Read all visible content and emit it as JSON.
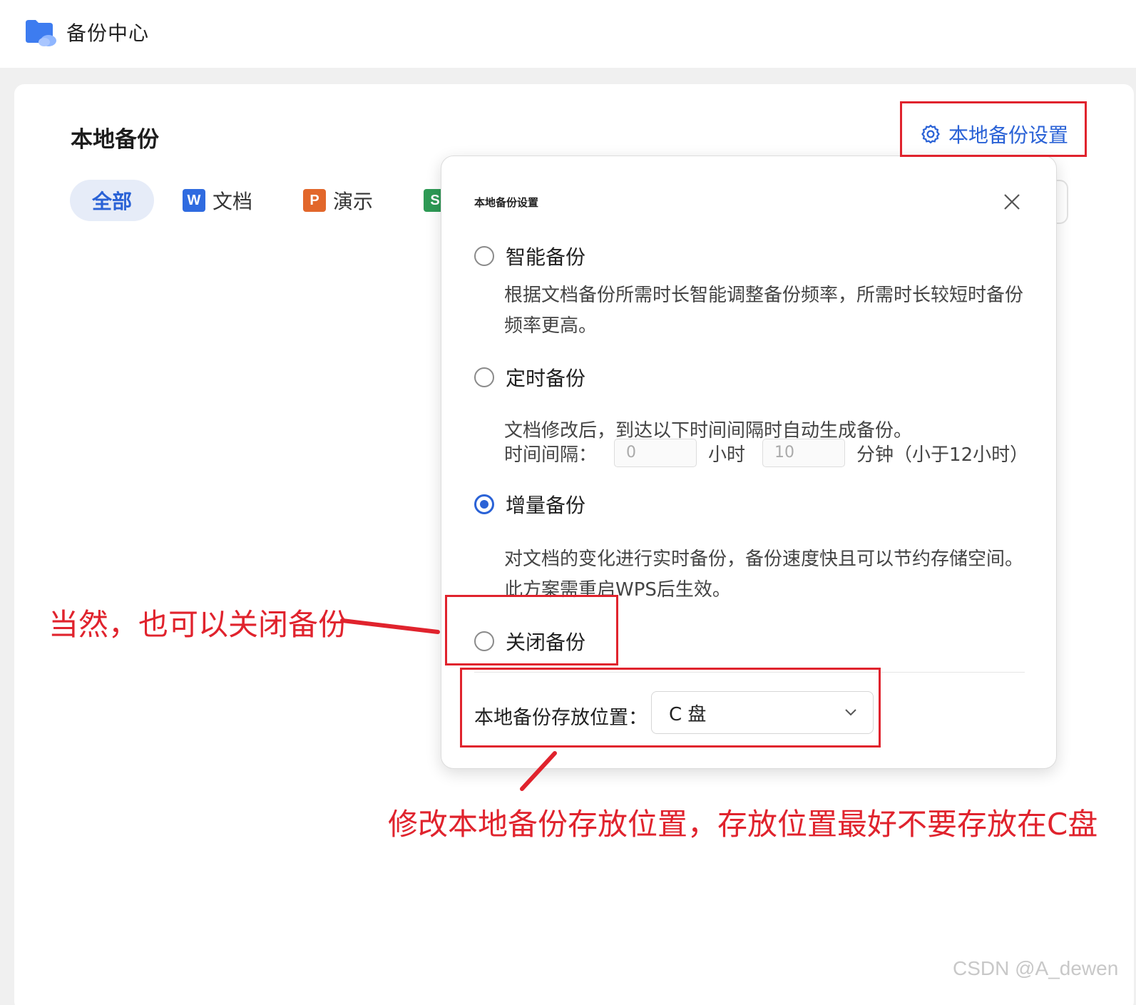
{
  "app": {
    "title": "备份中心"
  },
  "page": {
    "title": "本地备份",
    "settings_link": "本地备份设置"
  },
  "filters": [
    {
      "label": "全部",
      "active": true
    },
    {
      "label": "文档",
      "icon": "W",
      "icon_color": "#2f6be0"
    },
    {
      "label": "演示",
      "icon": "P",
      "icon_color": "#e2672b"
    },
    {
      "label": "",
      "icon": "S",
      "icon_color": "#2e9a55"
    }
  ],
  "dialog": {
    "title": "本地备份设置",
    "options": [
      {
        "label": "智能备份",
        "selected": false,
        "desc": "根据文档备份所需时长智能调整备份频率，所需时长较短时备份频率更高。"
      },
      {
        "label": "定时备份",
        "selected": false,
        "desc": "文档修改后，到达以下时间间隔时自动生成备份。"
      },
      {
        "label": "增量备份",
        "selected": true,
        "desc": "对文档的变化进行实时备份，备份速度快且可以节约存储空间。此方案需重启WPS后生效。"
      },
      {
        "label": "关闭备份",
        "selected": false
      }
    ],
    "interval": {
      "label": "时间间隔：",
      "hours_value": "0",
      "hours_unit": "小时",
      "minutes_value": "10",
      "minutes_unit": "分钟（小于12小时）"
    },
    "location": {
      "label": "本地备份存放位置：",
      "value": "C 盘"
    }
  },
  "annotations": {
    "close_backup_note": "当然，也可以关闭备份",
    "location_note": "修改本地备份存放位置，存放位置最好不要存放在C盘"
  },
  "watermark": "CSDN @A_dewen",
  "colors": {
    "accent": "#2a62d6",
    "annotation": "#e0232d"
  }
}
